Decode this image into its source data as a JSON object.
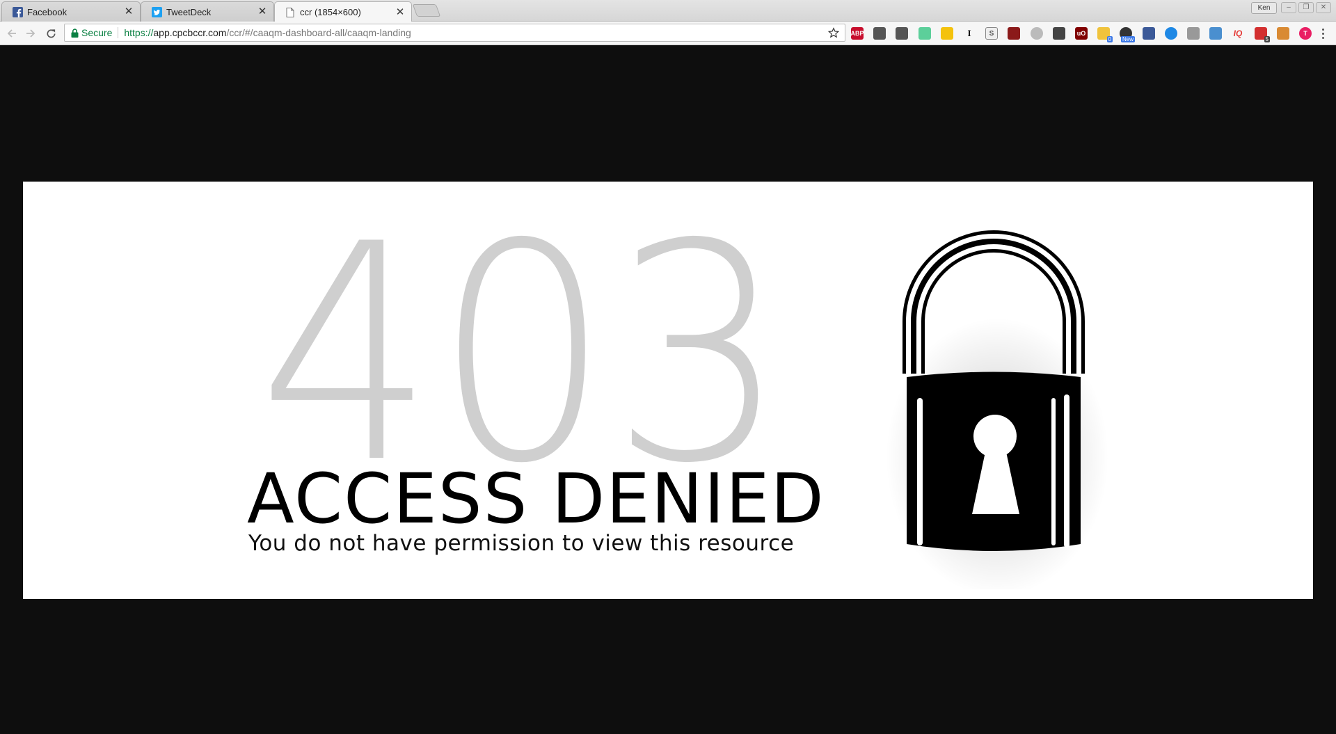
{
  "browser": {
    "tabs": [
      {
        "title": "Facebook",
        "icon": "facebook-icon",
        "active": false
      },
      {
        "title": "TweetDeck",
        "icon": "tweetdeck-icon",
        "active": false
      },
      {
        "title": "ccr (1854×600)",
        "icon": "document-icon",
        "active": true
      }
    ],
    "profile_name": "Ken",
    "address": {
      "security_label": "Secure",
      "url_scheme": "https://",
      "url_host": "app.cpcbccr.com",
      "url_path": "/ccr/#/caaqm-dashboard-all/caaqm-landing"
    },
    "extensions": [
      {
        "name": "adblock-plus-icon",
        "label": "ABP",
        "color": "#c70d2c"
      },
      {
        "name": "share-icon",
        "label": "",
        "color": "#555555"
      },
      {
        "name": "evernote-icon",
        "label": "",
        "color": "#555555"
      },
      {
        "name": "grammarly-icon",
        "label": "",
        "color": "#5ccf9a"
      },
      {
        "name": "keep-icon",
        "label": "",
        "color": "#f4c20d"
      },
      {
        "name": "instapaper-icon",
        "label": "I",
        "color": "#111111"
      },
      {
        "name": "s-extension-icon",
        "label": "S",
        "color": "#555555"
      },
      {
        "name": "red-square-icon",
        "label": "",
        "color": "#8b1a1a"
      },
      {
        "name": "gray-circle-icon",
        "label": "",
        "color": "#bbbbbb"
      },
      {
        "name": "pocket-icon",
        "label": "",
        "color": "#444444"
      },
      {
        "name": "ublock-icon",
        "label": "uO",
        "color": "#800000"
      },
      {
        "name": "folder-icon",
        "label": "",
        "color": "#f0c33c",
        "badge": "0",
        "badge_color": "#3b78e7"
      },
      {
        "name": "new-extension-icon",
        "label": "",
        "color": "#333333",
        "badge": "New",
        "badge_color": "#3b78e7"
      },
      {
        "name": "tools-icon",
        "label": "",
        "color": "#3b5998"
      },
      {
        "name": "blue-circle-icon",
        "label": "",
        "color": "#1e88e5"
      },
      {
        "name": "image-icon",
        "label": "",
        "color": "#999999"
      },
      {
        "name": "eye-dropper-icon",
        "label": "",
        "color": "#4a8fcf"
      },
      {
        "name": "iq-icon",
        "label": "IQ",
        "color": "#e53935"
      },
      {
        "name": "counter-icon",
        "label": "",
        "color": "#d32f2f",
        "badge": "5",
        "badge_color": "#444444"
      },
      {
        "name": "bag-icon",
        "label": "",
        "color": "#d98a33"
      },
      {
        "name": "t-extension-icon",
        "label": "T",
        "color": "#e91e63"
      }
    ]
  },
  "page": {
    "error_code": "403",
    "heading": "ACCESS DENIED",
    "message": "You do not have permission to view this resource",
    "colors": {
      "background": "#0e0e0e",
      "banner": "#ffffff",
      "code_digits": "#cfcfcf",
      "text": "#000000"
    }
  }
}
